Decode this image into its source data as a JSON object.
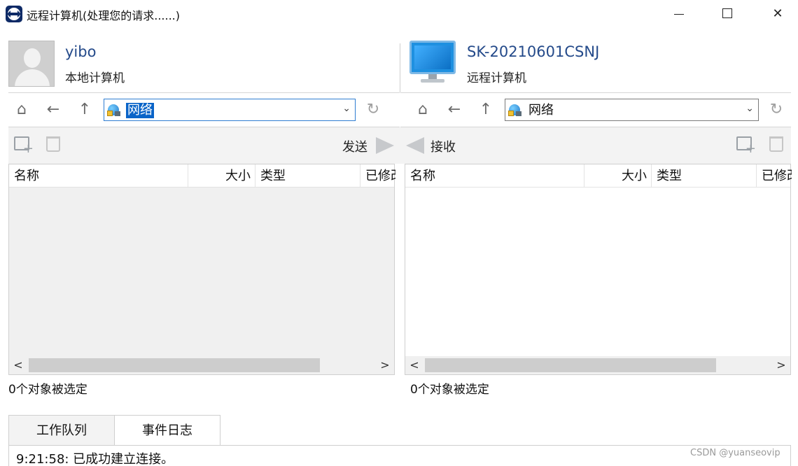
{
  "window": {
    "title": "远程计算机(处理您的请求......)",
    "minimize": "",
    "maximize": "",
    "close": "✕"
  },
  "local": {
    "name": "yibo",
    "label": "本地计算机",
    "address": "网络",
    "send_label": "发送",
    "status": "0个对象被选定",
    "columns": [
      "名称",
      "大小",
      "类型",
      "已修改"
    ]
  },
  "remote": {
    "name": "SK-20210601CSNJ",
    "label": "远程计算机",
    "address": "网络",
    "receive_label": "接收",
    "status": "0个对象被选定",
    "columns": [
      "名称",
      "大小",
      "类型",
      "已修改"
    ]
  },
  "icons": {
    "home": "⌂",
    "back": "←",
    "up": "↑",
    "refresh": "↻",
    "dropdown": "⌄",
    "scroll_left": "<",
    "scroll_right": ">"
  },
  "tabs": [
    {
      "label": "工作队列",
      "active": false
    },
    {
      "label": "事件日志",
      "active": true
    }
  ],
  "log": {
    "line": "9:21:58: 已成功建立连接。"
  },
  "watermark": "CSDN @yuanseovip",
  "colors": {
    "name_blue": "#244a8a",
    "selection": "#0a64c8"
  }
}
